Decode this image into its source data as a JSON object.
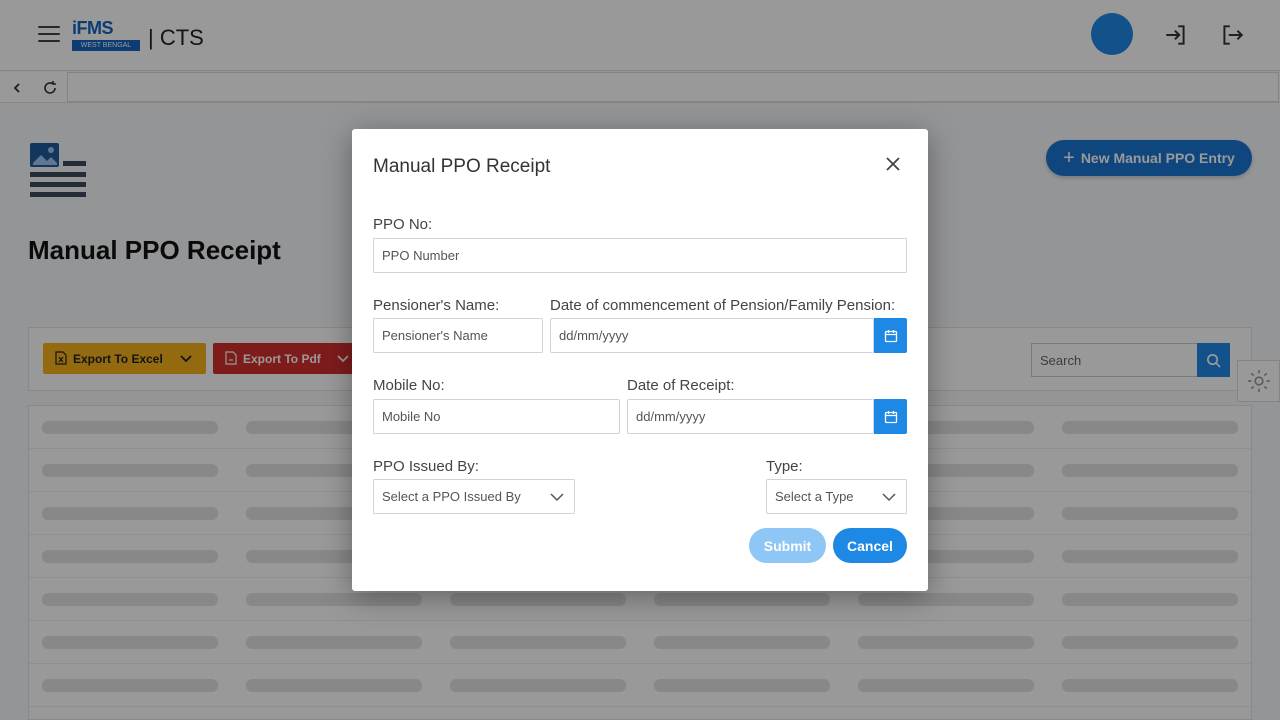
{
  "header": {
    "logo_text": "iFMS",
    "logo_sub": "WEST BENGAL",
    "app_name": "| CTS"
  },
  "page": {
    "title": "Manual PPO Receipt",
    "new_entry_label": "New Manual PPO Entry",
    "export_excel_label": "Export To Excel",
    "export_pdf_label": "Export To Pdf",
    "search_placeholder": "Search"
  },
  "modal": {
    "title": "Manual PPO Receipt",
    "ppo_no_label": "PPO No:",
    "ppo_no_placeholder": "PPO Number",
    "pensioner_name_label": "Pensioner's Name:",
    "pensioner_name_placeholder": "Pensioner's Name",
    "commencement_label": "Date of commencement of Pension/Family Pension:",
    "commencement_placeholder": "dd/mm/yyyy",
    "mobile_label": "Mobile No:",
    "mobile_placeholder": "Mobile No",
    "receipt_date_label": "Date of Receipt:",
    "receipt_date_placeholder": "dd/mm/yyyy",
    "issued_by_label": "PPO Issued By:",
    "issued_by_value": "Select a PPO Issued By",
    "type_label": "Type:",
    "type_value": "Select a Type",
    "submit_label": "Submit",
    "cancel_label": "Cancel"
  },
  "colors": {
    "primary": "#1e88e5",
    "excel": "#f5b11a",
    "pdf": "#d32f2f",
    "submit_disabled": "#8ec6f5"
  }
}
